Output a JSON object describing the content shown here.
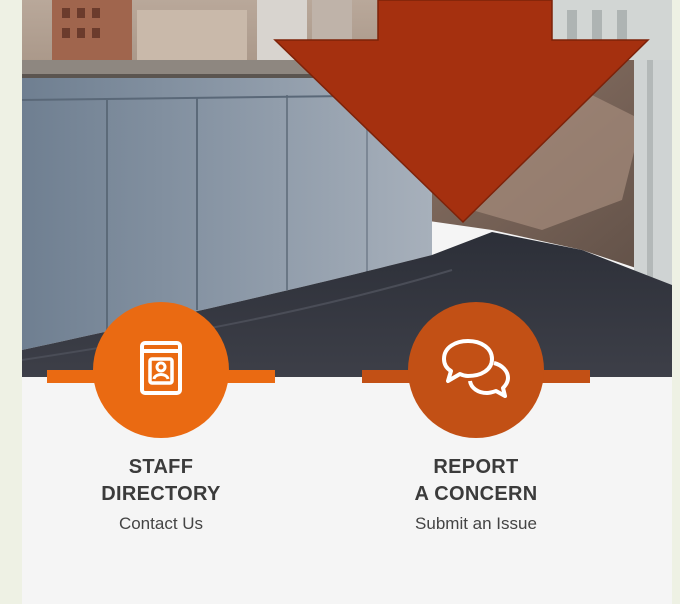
{
  "tiles": [
    {
      "icon": "contact-book-icon",
      "title_line1": "STAFF",
      "title_line2": "DIRECTORY",
      "subtitle": "Contact Us",
      "color": "#ea6a12"
    },
    {
      "icon": "chat-bubbles-icon",
      "title_line1": "REPORT",
      "title_line2": "A CONCERN",
      "subtitle": "Submit an Issue",
      "color": "#c25015"
    }
  ],
  "hero": {
    "image": "dam-photo"
  },
  "annotation": {
    "icon": "down-arrow-icon",
    "color": "#a5300f"
  }
}
